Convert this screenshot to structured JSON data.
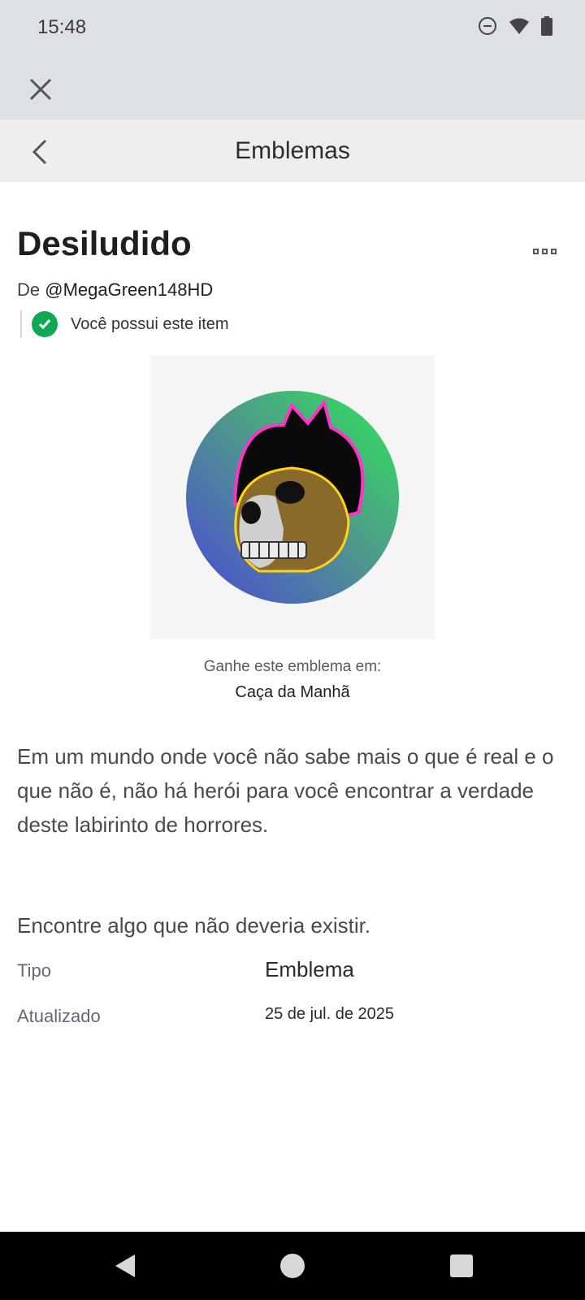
{
  "status_bar": {
    "time": "15:48",
    "icons": [
      "do-not-disturb-icon",
      "wifi-icon",
      "battery-icon"
    ]
  },
  "header": {
    "title": "Emblemas"
  },
  "item": {
    "title": "Desiludido",
    "creator_prefix": "De",
    "creator_handle": "@MegaGreen148HD",
    "owned_text": "Você possui este item",
    "earn_label": "Ganhe este emblema em:",
    "earn_game": "Caça da Manhã",
    "description": "Em um mundo onde você não sabe mais o que é real e o que não é, não há herói para você encontrar a verdade deste labirinto de horrores.",
    "hint": "Encontre algo que não deveria existir."
  },
  "details": [
    {
      "label": "Tipo",
      "value": "Emblema"
    },
    {
      "label": "Atualizado",
      "value": "25 de jul. de 2025"
    }
  ],
  "colors": {
    "status_bg": "#dde0e4",
    "header_bg": "#eceef0",
    "owned_check": "#11a853"
  }
}
